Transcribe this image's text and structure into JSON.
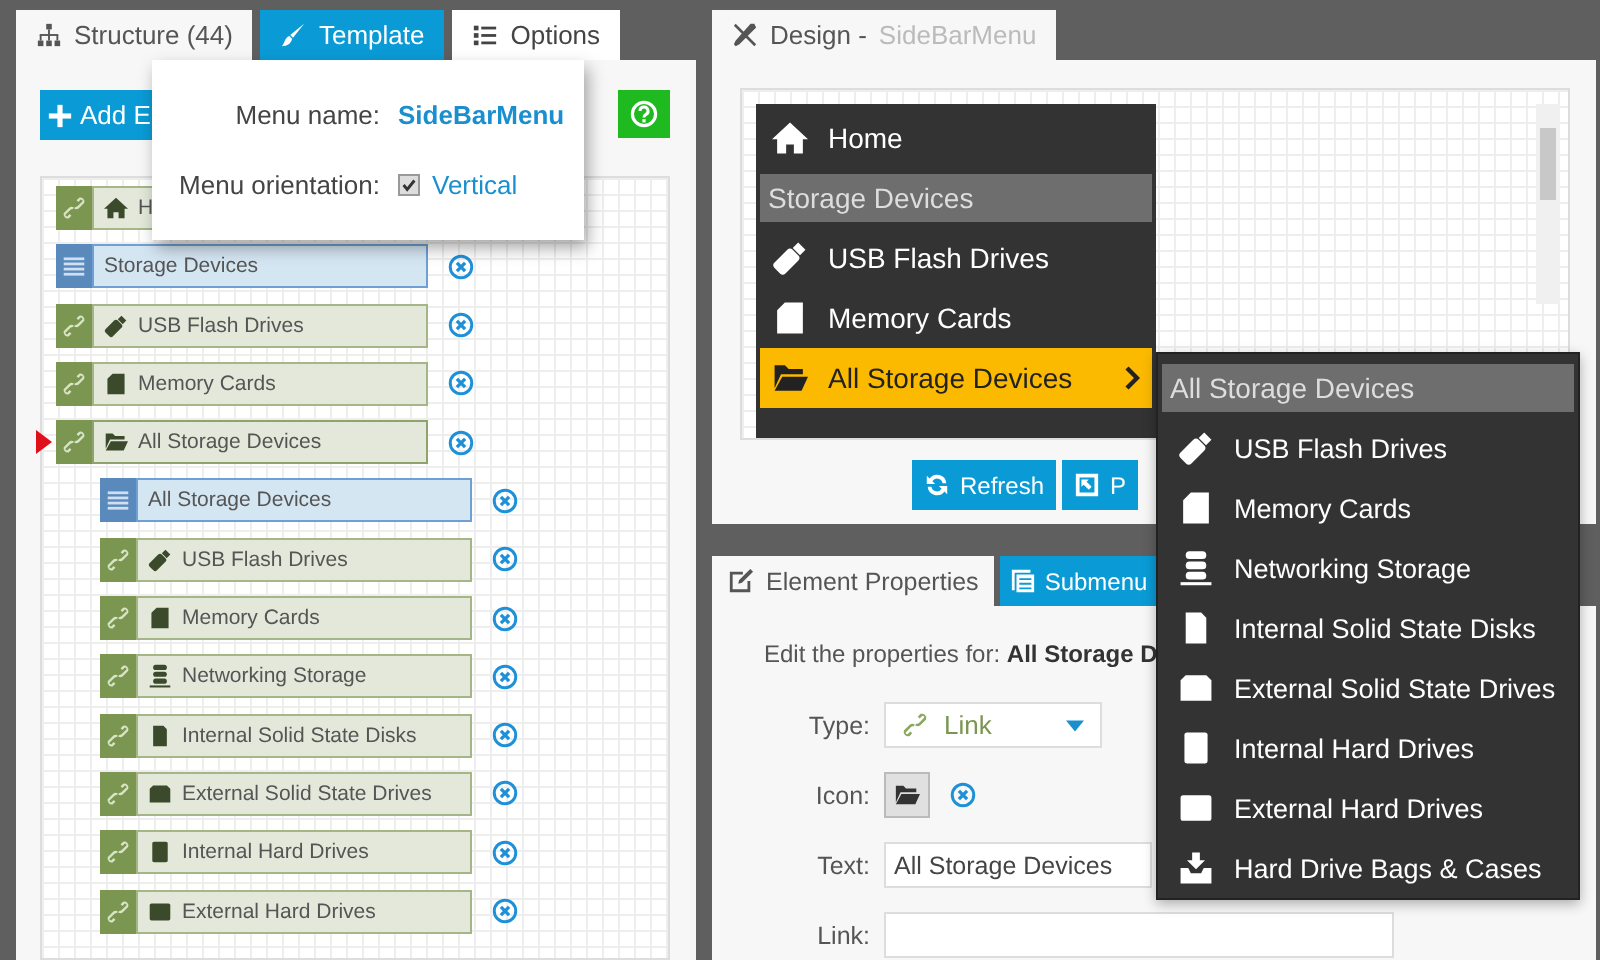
{
  "structure_panel": {
    "tabs": [
      {
        "label": "Structure (44)",
        "selected": true,
        "open": false
      },
      {
        "label": "Template",
        "selected": false,
        "open": false
      },
      {
        "label": "Options",
        "selected": false,
        "open": true
      }
    ],
    "add_button": "Add E",
    "tree": [
      {
        "kind": "link",
        "label": "H",
        "selected": false
      },
      {
        "kind": "header",
        "label": "Storage Devices",
        "selected": false
      },
      {
        "kind": "link",
        "label": "USB Flash Drives",
        "selected": false
      },
      {
        "kind": "link",
        "label": "Memory Cards",
        "selected": false
      },
      {
        "kind": "link",
        "label": "All Storage Devices",
        "selected": true,
        "children": [
          {
            "kind": "header",
            "label": "All Storage Devices",
            "selected": false
          },
          {
            "kind": "link",
            "label": "USB Flash Drives",
            "selected": false
          },
          {
            "kind": "link",
            "label": "Memory Cards",
            "selected": false
          },
          {
            "kind": "link",
            "label": "Networking Storage",
            "selected": false
          },
          {
            "kind": "link",
            "label": "Internal Solid State Disks",
            "selected": false
          },
          {
            "kind": "link",
            "label": "External Solid State Drives",
            "selected": false
          },
          {
            "kind": "link",
            "label": "Internal Hard Drives",
            "selected": false
          },
          {
            "kind": "link",
            "label": "External Hard Drives",
            "selected": false
          }
        ]
      }
    ]
  },
  "options_popup": {
    "menu_name_label": "Menu name:",
    "menu_name": "SideBarMenu",
    "orientation_label": "Menu orientation:",
    "orientation_checked": true,
    "orientation": "Vertical"
  },
  "design_panel": {
    "tab": {
      "label": "Design - ",
      "menu_name": "SideBarMenu"
    },
    "menu": [
      {
        "kind": "link",
        "label": "Home",
        "selected": false
      },
      {
        "kind": "header",
        "label": "Storage Devices",
        "selected": false
      },
      {
        "kind": "link",
        "label": "USB Flash Drives",
        "selected": false
      },
      {
        "kind": "link",
        "label": "Memory Cards",
        "selected": false
      },
      {
        "kind": "link",
        "label": "All Storage Devices",
        "selected": true
      }
    ],
    "buttons": [
      "Refresh",
      "P"
    ]
  },
  "submenu": [
    {
      "kind": "header",
      "label": "All Storage Devices"
    },
    {
      "kind": "link",
      "label": "USB Flash Drives"
    },
    {
      "kind": "link",
      "label": "Memory Cards"
    },
    {
      "kind": "link",
      "label": "Networking Storage"
    },
    {
      "kind": "link",
      "label": "Internal Solid State Disks"
    },
    {
      "kind": "link",
      "label": "External Solid State Drives"
    },
    {
      "kind": "link",
      "label": "Internal Hard Drives"
    },
    {
      "kind": "link",
      "label": "External Hard Drives"
    },
    {
      "kind": "link",
      "label": "Hard Drive Bags & Cases"
    }
  ],
  "properties_panel": {
    "tabs": [
      {
        "label": "Element Properties",
        "selected": true
      },
      {
        "label": "Submenu",
        "selected": false
      }
    ],
    "intro": "Edit the properties for: **All Storage D**",
    "fields": [
      {
        "kind": "select",
        "label": "Type:",
        "value": "Link"
      },
      {
        "kind": "icon",
        "label": "Icon:"
      },
      {
        "kind": "text",
        "label": "Text:",
        "value": "All Storage Devices"
      },
      {
        "kind": "text",
        "label": "Link:"
      }
    ]
  }
}
